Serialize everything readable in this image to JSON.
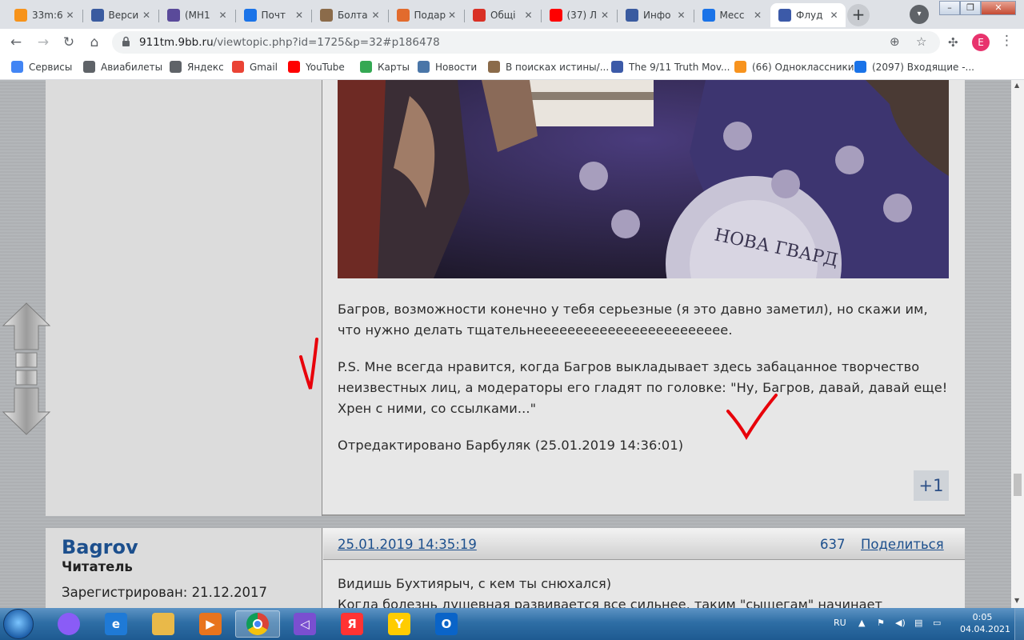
{
  "browser": {
    "tabs": [
      {
        "title": "33m:6",
        "favicon": "bitcoin-icon",
        "color": "#f7931a"
      },
      {
        "title": "Верси",
        "favicon": "double-chevron-icon",
        "color": "#3a5ba0"
      },
      {
        "title": "(МН1",
        "favicon": "person-icon",
        "color": "#5a4a9a"
      },
      {
        "title": "Почт",
        "favicon": "mail-icon",
        "color": "#1a73e8"
      },
      {
        "title": "Болта",
        "favicon": "pin-icon",
        "color": "#8b6b4a"
      },
      {
        "title": "Подар",
        "favicon": "ppt-icon",
        "color": "#e26b2d"
      },
      {
        "title": "Общі",
        "favicon": "red-circle-icon",
        "color": "#d93025"
      },
      {
        "title": "(37) Л",
        "favicon": "youtube-icon",
        "color": "#ff0000"
      },
      {
        "title": "Инфо",
        "favicon": "double-chevron-icon",
        "color": "#3a5ba0"
      },
      {
        "title": "Месс",
        "favicon": "chat-icon",
        "color": "#1a73e8"
      },
      {
        "title": "Флуд",
        "favicon": "forum-icon",
        "color": "#3c5aa8",
        "active": true
      }
    ],
    "new_tab_label": "+",
    "profile_initial": "E",
    "address": {
      "host": "911tm.9bb.ru",
      "path": "/viewtopic.php?id=1725&p=32#p186478"
    },
    "bookmarks": [
      {
        "label": "Сервисы",
        "icon": "apps-grid-icon",
        "color": "#4285f4"
      },
      {
        "label": "Авиабилеты",
        "icon": "globe-icon",
        "color": "#5f6368"
      },
      {
        "label": "Яндекс",
        "icon": "globe-icon",
        "color": "#5f6368"
      },
      {
        "label": "Gmail",
        "icon": "gmail-icon",
        "color": "#ea4335"
      },
      {
        "label": "YouTube",
        "icon": "youtube-icon",
        "color": "#ff0000"
      },
      {
        "label": "Карты",
        "icon": "maps-icon",
        "color": "#34a853"
      },
      {
        "label": "Новости",
        "icon": "vk-icon",
        "color": "#4a76a8"
      },
      {
        "label": "В поисках истины/...",
        "icon": "pin-icon",
        "color": "#8b6b4a"
      },
      {
        "label": "The 9/11 Truth Mov...",
        "icon": "forum-icon",
        "color": "#3c5aa8"
      },
      {
        "label": "(66) Одноклассники",
        "icon": "mail-icon",
        "color": "#f7931e"
      },
      {
        "label": "(2097) Входящие -...",
        "icon": "mail-icon",
        "color": "#1a73e8"
      }
    ]
  },
  "post1": {
    "paragraph1": "Багров, возможности конечно у тебя серьезные (я это давно заметил), но скажи им, что нужно делать тщательнееееееееееееееееееееееее.",
    "paragraph2": "P.S. Мне всегда нравится, когда Багров выкладывает здесь забацанное творчество неизвестных лиц, а модераторы его гладят по головке: \"Ну, Багров, давай, давай еще! Хрен с ними, со ссылками...\"",
    "edited": "Отредактировано Барбуляк (25.01.2019 14:36:01)",
    "rating": "+1",
    "annotation_color": "#e8000a"
  },
  "post2": {
    "username": "Bagrov",
    "rank": "Читатель",
    "registered": "Зарегистрирован: 21.12.2017",
    "date": "25.01.2019 14:35:19",
    "number": "637",
    "share": "Поделиться",
    "line1": "Видишь Бухтиярыч, с кем ты  снюхался)",
    "line2": "Когда болезнь душевная развивается все сильнее, таким \"сыщегам\" начинает"
  },
  "taskbar": {
    "lang": "RU",
    "time": "0:05",
    "date": "04.04.2021",
    "apps": [
      {
        "name": "alice-icon",
        "color": "#8a5cf6",
        "glyph": ""
      },
      {
        "name": "ie-icon",
        "color": "#1f7ad6",
        "glyph": "e"
      },
      {
        "name": "explorer-icon",
        "color": "#e9b949",
        "glyph": ""
      },
      {
        "name": "media-player-icon",
        "color": "#e8741e",
        "glyph": "▶"
      },
      {
        "name": "chrome-icon",
        "color": "#ffffff",
        "glyph": "",
        "active": true
      },
      {
        "name": "vs-icon",
        "color": "#7a4fd0",
        "glyph": "◁"
      },
      {
        "name": "yandex-icon",
        "color": "#ff3333",
        "glyph": "Я"
      },
      {
        "name": "yandex-browser-icon",
        "color": "#ffcc00",
        "glyph": "Y"
      },
      {
        "name": "outlook-icon",
        "color": "#0a64c8",
        "glyph": "O"
      }
    ]
  }
}
